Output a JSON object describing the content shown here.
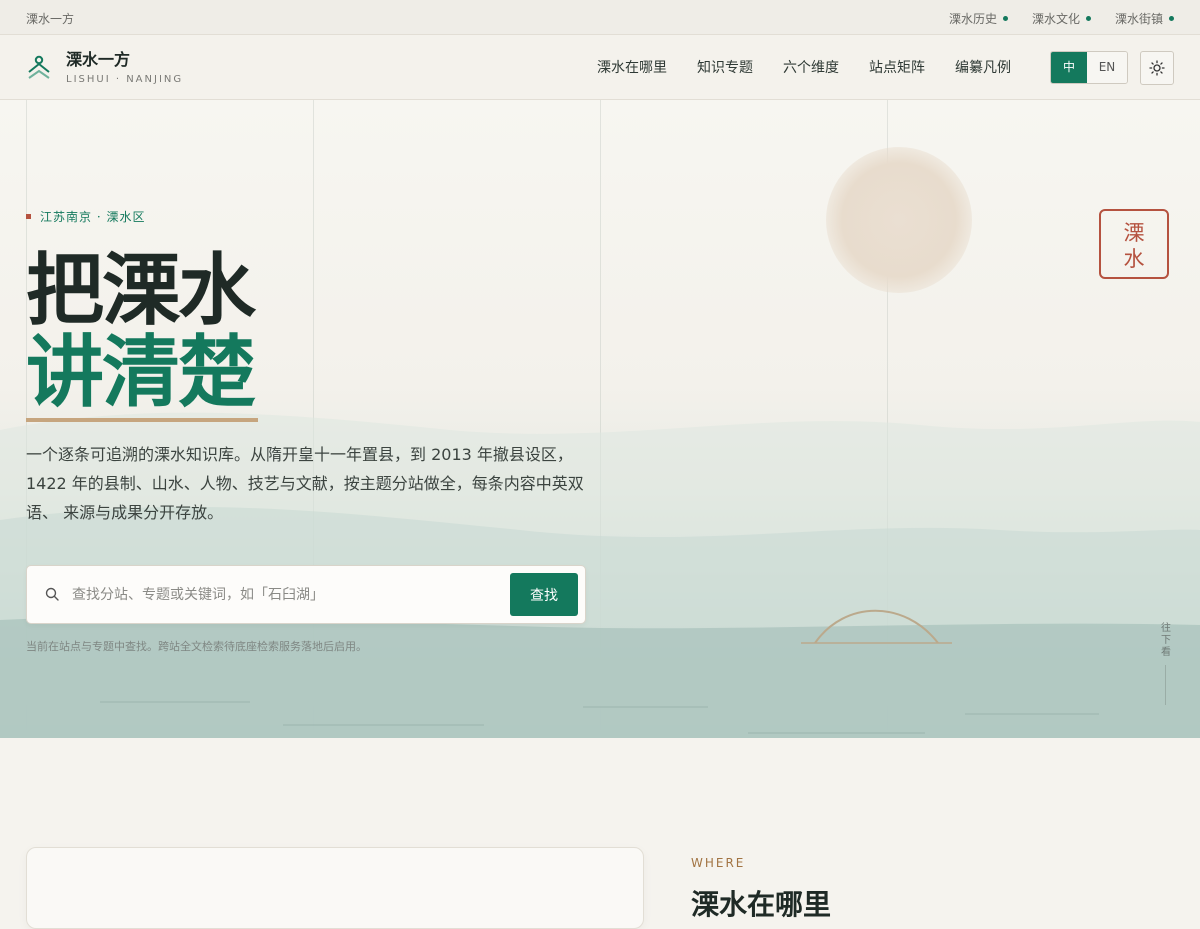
{
  "topbar": {
    "site_name": "溧水一方",
    "links": [
      "溧水历史",
      "溧水文化",
      "溧水街镇"
    ]
  },
  "header": {
    "logo_cn": "溧水一方",
    "logo_en": "LISHUI · NANJING",
    "nav": [
      "溧水在哪里",
      "知识专题",
      "六个维度",
      "站点矩阵",
      "编纂凡例"
    ],
    "lang_zh": "中",
    "lang_en": "EN"
  },
  "hero": {
    "eyebrow": "江苏南京 · 溧水区",
    "title_line1": "把溧水",
    "title_line2": "讲清楚",
    "lead": "一个逐条可追溯的溧水知识库。从隋开皇十一年置县，到 2013 年撤县设区，1422 年的县制、山水、人物、技艺与文献，按主题分站做全，每条内容中英双语、 来源与成果分开存放。",
    "seal": "溧水",
    "search_placeholder": "查找分站、专题或关键词，如「石臼湖」",
    "search_button": "查找",
    "hint": "当前在站点与专题中查找。跨站全文检索待底座检索服务落地后启用。",
    "scroll_hint": "往下看"
  },
  "section": {
    "eyebrow": "WHERE",
    "title": "溧水在哪里"
  },
  "colors": {
    "accent": "#14795d",
    "seal": "#b5523f",
    "gold": "#c6a57e"
  }
}
